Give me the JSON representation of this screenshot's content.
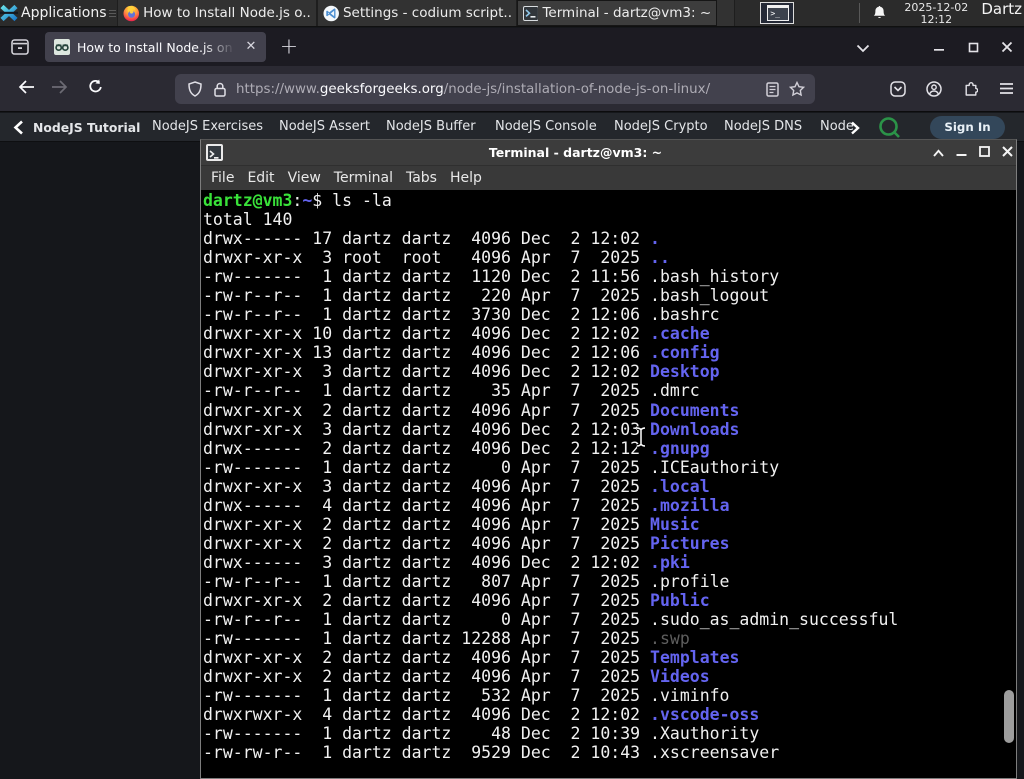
{
  "panel": {
    "applications_label": "Applications",
    "windows": [
      {
        "icon": "firefox",
        "label": "How to Install Node.js o..."
      },
      {
        "icon": "codium",
        "label": "Settings - codium script..."
      },
      {
        "icon": "terminal",
        "label": "Terminal - dartz@vm3: ~"
      }
    ],
    "clock_date": "2025-12-02",
    "clock_time": "12:12",
    "user_label": "Dartz"
  },
  "browser": {
    "tab_title": "How to Install Node.js on",
    "new_tab_label": "+",
    "url_prefix": "https://www.",
    "url_domain": "geeksforgeeks.org",
    "url_path": "/node-js/installation-of-node-js-on-linux/"
  },
  "page": {
    "nav_items": [
      "NodeJS Tutorial",
      "NodeJS Exercises",
      "NodeJS Assert",
      "NodeJS Buffer",
      "NodeJS Console",
      "NodeJS Crypto",
      "NodeJS DNS",
      "Node"
    ],
    "sign_in_label": "Sign In"
  },
  "colors": {
    "terminal_background": "#000000",
    "terminal_foreground": "#f1f1f1",
    "terminal_green": "#39e239",
    "terminal_blue": "#6464f0",
    "terminal_dim": "#5e5e5e",
    "gfg_green": "#2b9348",
    "sign_in_background": "#33475a",
    "urlbar_background": "#42414d",
    "panel_background": "#2b2b2b"
  },
  "terminal": {
    "title": "Terminal - dartz@vm3: ~",
    "menus": [
      "File",
      "Edit",
      "View",
      "Terminal",
      "Tabs",
      "Help"
    ],
    "prompt_user": "dartz@vm3",
    "prompt_sep": ":",
    "prompt_dir": "~",
    "prompt_cmd": "$ ls -la",
    "lines": [
      [
        [
          "tgreen",
          "dartz@vm3"
        ],
        [
          "tfg",
          ":"
        ],
        [
          "tblue",
          "~"
        ],
        [
          "tfg",
          "$ ls -la"
        ]
      ],
      [
        [
          "tfg",
          "total 140"
        ]
      ],
      [
        [
          "tfg",
          "drwx------ 17 dartz dartz  4096 Dec  2 12:02 "
        ],
        [
          "tblue",
          "."
        ]
      ],
      [
        [
          "tfg",
          "drwxr-xr-x  3 root  root   4096 Apr  7  2025 "
        ],
        [
          "tblue",
          ".."
        ]
      ],
      [
        [
          "tfg",
          "-rw-------  1 dartz dartz  1120 Dec  2 11:56 .bash_history"
        ]
      ],
      [
        [
          "tfg",
          "-rw-r--r--  1 dartz dartz   220 Apr  7  2025 .bash_logout"
        ]
      ],
      [
        [
          "tfg",
          "-rw-r--r--  1 dartz dartz  3730 Dec  2 12:06 .bashrc"
        ]
      ],
      [
        [
          "tfg",
          "drwxr-xr-x 10 dartz dartz  4096 Dec  2 12:02 "
        ],
        [
          "tblue",
          ".cache"
        ]
      ],
      [
        [
          "tfg",
          "drwxr-xr-x 13 dartz dartz  4096 Dec  2 12:06 "
        ],
        [
          "tblue",
          ".config"
        ]
      ],
      [
        [
          "tfg",
          "drwxr-xr-x  3 dartz dartz  4096 Dec  2 12:02 "
        ],
        [
          "tblue",
          "Desktop"
        ]
      ],
      [
        [
          "tfg",
          "-rw-r--r--  1 dartz dartz    35 Apr  7  2025 .dmrc"
        ]
      ],
      [
        [
          "tfg",
          "drwxr-xr-x  2 dartz dartz  4096 Apr  7  2025 "
        ],
        [
          "tblue",
          "Documents"
        ]
      ],
      [
        [
          "tfg",
          "drwxr-xr-x  3 dartz dartz  4096 Dec  2 12:03 "
        ],
        [
          "tblue",
          "Downloads"
        ]
      ],
      [
        [
          "tfg",
          "drwx------  2 dartz dartz  4096 Dec  2 12:12 "
        ],
        [
          "tblue",
          ".gnupg"
        ]
      ],
      [
        [
          "tfg",
          "-rw-------  1 dartz dartz     0 Apr  7  2025 .ICEauthority"
        ]
      ],
      [
        [
          "tfg",
          "drwxr-xr-x  3 dartz dartz  4096 Apr  7  2025 "
        ],
        [
          "tblue",
          ".local"
        ]
      ],
      [
        [
          "tfg",
          "drwx------  4 dartz dartz  4096 Apr  7  2025 "
        ],
        [
          "tblue",
          ".mozilla"
        ]
      ],
      [
        [
          "tfg",
          "drwxr-xr-x  2 dartz dartz  4096 Apr  7  2025 "
        ],
        [
          "tblue",
          "Music"
        ]
      ],
      [
        [
          "tfg",
          "drwxr-xr-x  2 dartz dartz  4096 Apr  7  2025 "
        ],
        [
          "tblue",
          "Pictures"
        ]
      ],
      [
        [
          "tfg",
          "drwx------  3 dartz dartz  4096 Dec  2 12:02 "
        ],
        [
          "tblue",
          ".pki"
        ]
      ],
      [
        [
          "tfg",
          "-rw-r--r--  1 dartz dartz   807 Apr  7  2025 .profile"
        ]
      ],
      [
        [
          "tfg",
          "drwxr-xr-x  2 dartz dartz  4096 Apr  7  2025 "
        ],
        [
          "tblue",
          "Public"
        ]
      ],
      [
        [
          "tfg",
          "-rw-r--r--  1 dartz dartz     0 Apr  7  2025 .sudo_as_admin_successful"
        ]
      ],
      [
        [
          "tfg",
          "-rw-------  1 dartz dartz 12288 Apr  7  2025 "
        ],
        [
          "tdim",
          ".swp"
        ]
      ],
      [
        [
          "tfg",
          "drwxr-xr-x  2 dartz dartz  4096 Apr  7  2025 "
        ],
        [
          "tblue",
          "Templates"
        ]
      ],
      [
        [
          "tfg",
          "drwxr-xr-x  2 dartz dartz  4096 Apr  7  2025 "
        ],
        [
          "tblue",
          "Videos"
        ]
      ],
      [
        [
          "tfg",
          "-rw-------  1 dartz dartz   532 Apr  7  2025 .viminfo"
        ]
      ],
      [
        [
          "tfg",
          "drwxrwxr-x  4 dartz dartz  4096 Dec  2 12:02 "
        ],
        [
          "tblue",
          ".vscode-oss"
        ]
      ],
      [
        [
          "tfg",
          "-rw-------  1 dartz dartz    48 Dec  2 10:39 .Xauthority"
        ]
      ],
      [
        [
          "tfg",
          "-rw-rw-r--  1 dartz dartz  9529 Dec  2 10:43 .xscreensaver"
        ]
      ]
    ]
  }
}
